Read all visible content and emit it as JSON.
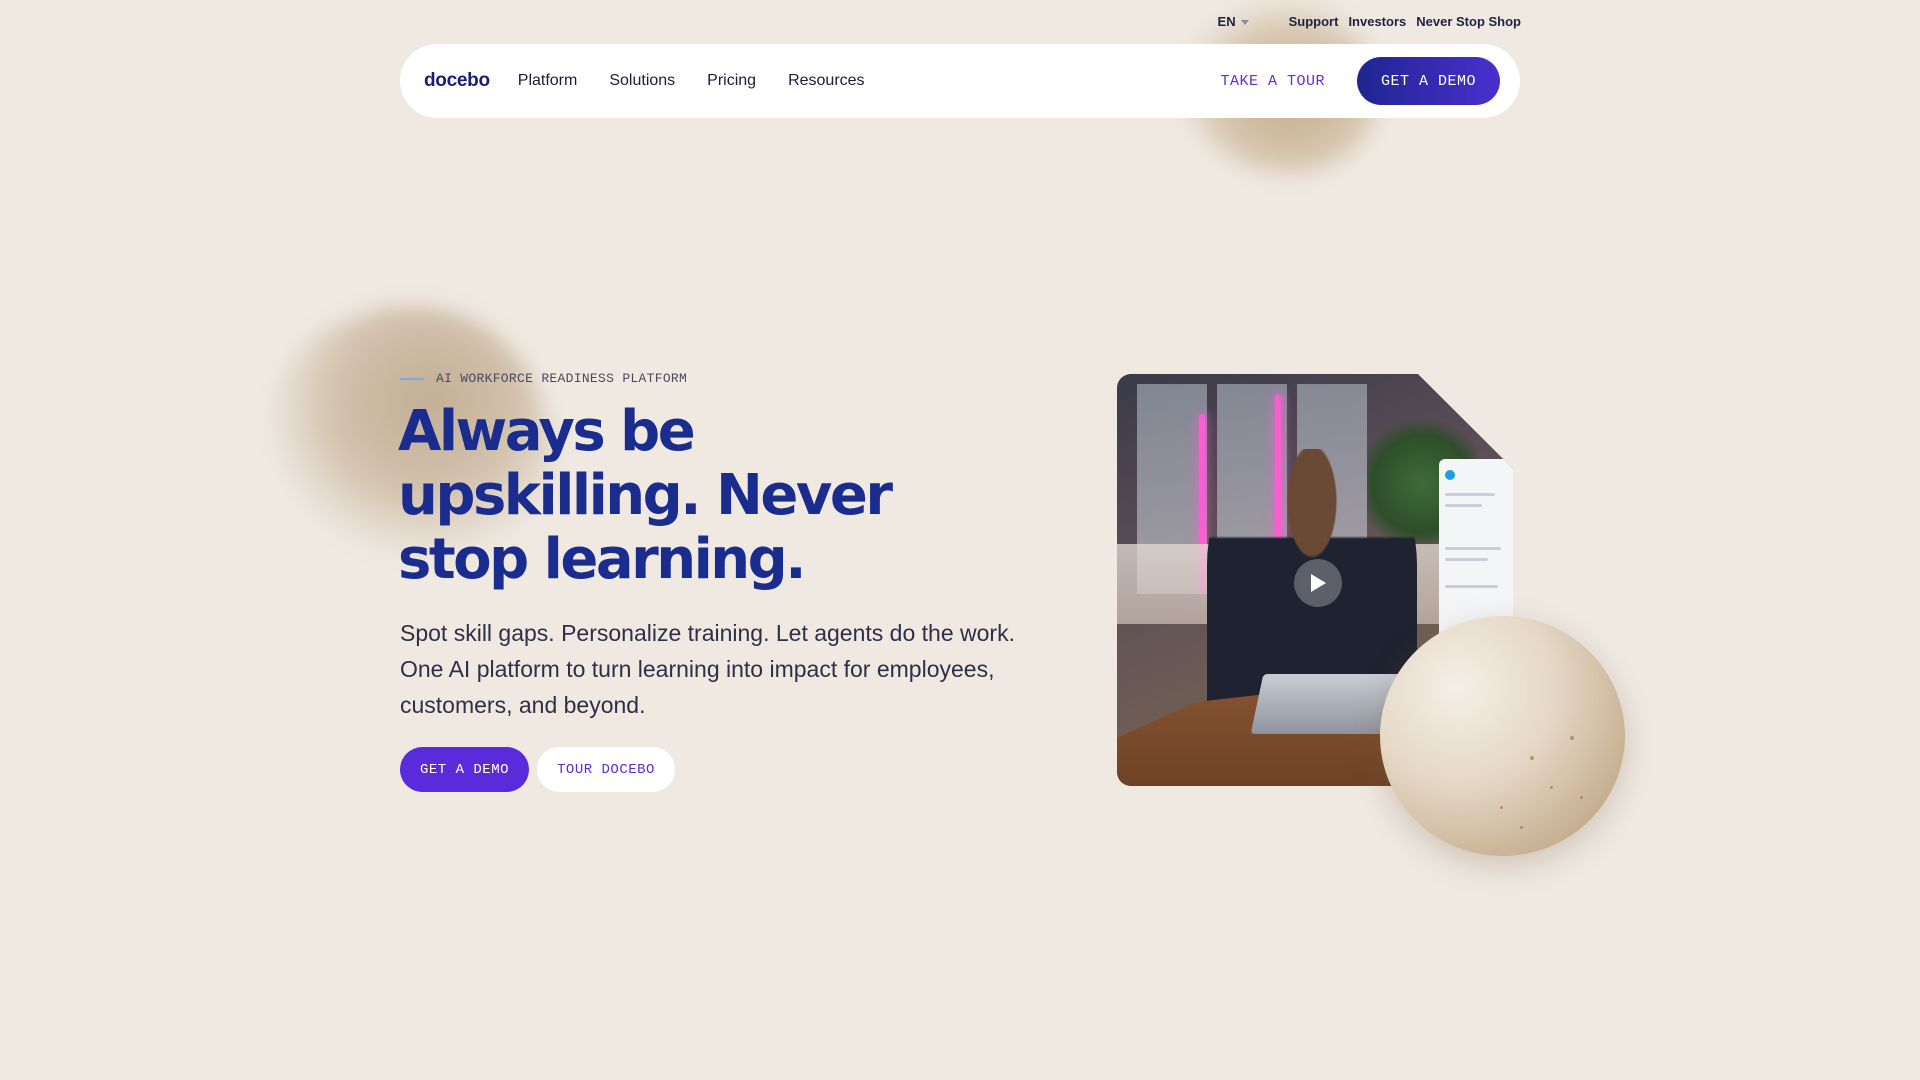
{
  "utility_bar": {
    "language": "EN",
    "links": [
      "Support",
      "Investors",
      "Never Stop Shop"
    ]
  },
  "nav": {
    "logo": "docebo",
    "items": [
      "Platform",
      "Solutions",
      "Pricing",
      "Resources"
    ],
    "tour_label": "TAKE A TOUR",
    "demo_label": "GET A DEMO"
  },
  "hero": {
    "eyebrow": "AI WORKFORCE READINESS PLATFORM",
    "headline": "Always be upskilling. Never stop learning.",
    "subtext": "Spot skill gaps. Personalize training. Let agents do the work. One AI platform to turn learning into impact for employees, customers, and beyond.",
    "cta_primary": "GET A DEMO",
    "cta_secondary": "TOUR DOCEBO"
  },
  "video": {
    "play_icon": "play-icon"
  },
  "colors": {
    "background": "#efe9e2",
    "brand_navy": "#1a2d8f",
    "brand_purple": "#5a2bdb"
  }
}
